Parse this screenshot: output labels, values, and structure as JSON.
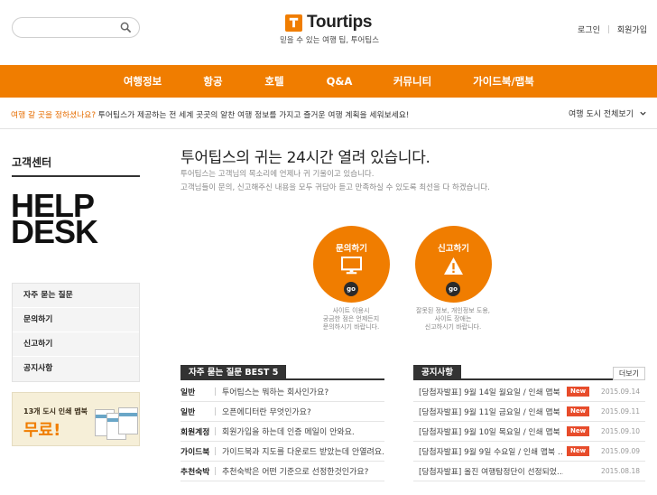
{
  "header": {
    "search": {
      "placeholder": ""
    },
    "logo": {
      "name": "Tourtips"
    },
    "tagline": "믿을 수 있는 여행 팁, 투어팁스",
    "links": {
      "login": "로그인",
      "join": "회원가입"
    }
  },
  "nav": {
    "items": [
      "여행정보",
      "항공",
      "호텔",
      "Q&A",
      "커뮤니티",
      "가이드북/맵북"
    ]
  },
  "promo": {
    "question": "여행 갈 곳을 정하셨나요?",
    "message": "투어팁스가 제공하는 전 세계 곳곳의 알찬 여행 정보를 가지고 즐거운 여행 계획을 세워보세요!",
    "city_select": "여행 도시 전체보기"
  },
  "sidebar": {
    "title": "고객센터",
    "help_line1": "HELP",
    "help_line2": "DESK",
    "menu": [
      "자주 묻는 질문",
      "문의하기",
      "신고하기",
      "공지사항"
    ],
    "banner": {
      "small": "13개 도시 인쇄 맵북",
      "big": "무료!"
    }
  },
  "main": {
    "title": "투어팁스의 귀는 24시간 열려 있습니다.",
    "desc1": "투어팁스는 고객님의 목소리에 언제나 귀 기울이고 있습니다.",
    "desc2": "고객님들이 문의, 신고해주신 내용을 모두 귀담아 듣고 만족하실 수 있도록 최선을 다 하겠습니다.",
    "inquiry": {
      "label": "문의하기",
      "go": "go",
      "note1": "사이트 이용시",
      "note2": "궁금한 점은 언제든지",
      "note3": "문의하시기 바랍니다."
    },
    "report": {
      "label": "신고하기",
      "go": "go",
      "note1": "잘못된 정보, 개인정보 도용,",
      "note2": "사이트 장애는",
      "note3": "신고하시기 바랍니다."
    }
  },
  "faq": {
    "title": "자주 묻는 질문 BEST 5",
    "rows": [
      {
        "cat": "일반",
        "q": "투어팁스는 뭐하는 회사인가요?"
      },
      {
        "cat": "일반",
        "q": "오픈에디터란 무엇인가요?"
      },
      {
        "cat": "회원계정",
        "q": "회원가입을 하는데 인증 메일이 안와요."
      },
      {
        "cat": "가이드북",
        "q": "가이드북과 지도를 다운로드 받았는데 안열려요."
      },
      {
        "cat": "추천숙박",
        "q": "추천숙박은 어떤 기준으로 선정한것인가요?"
      }
    ]
  },
  "notice": {
    "title": "공지사항",
    "more": "더보기",
    "new_label": "New",
    "rows": [
      {
        "title": "[당첨자발표] 9월 14일 월요일 / 인쇄 맵북 …",
        "date": "2015.09.14",
        "is_new": true
      },
      {
        "title": "[당첨자발표] 9월 11일 금요일 / 인쇄 맵북 …",
        "date": "2015.09.11",
        "is_new": true
      },
      {
        "title": "[당첨자발표] 9월 10일 목요일 / 인쇄 맵북 …",
        "date": "2015.09.10",
        "is_new": true
      },
      {
        "title": "[당첨자발표] 9월 9일 수요일 / 인쇄 맵북 …",
        "date": "2015.09.09",
        "is_new": true
      },
      {
        "title": "[당첨자발표] 올진 여행탐정단이 선정되었…",
        "date": "2015.08.18",
        "is_new": false
      }
    ]
  },
  "colors": {
    "brand": "#f07d00",
    "dark": "#333333",
    "new_badge": "#e74c2b"
  }
}
